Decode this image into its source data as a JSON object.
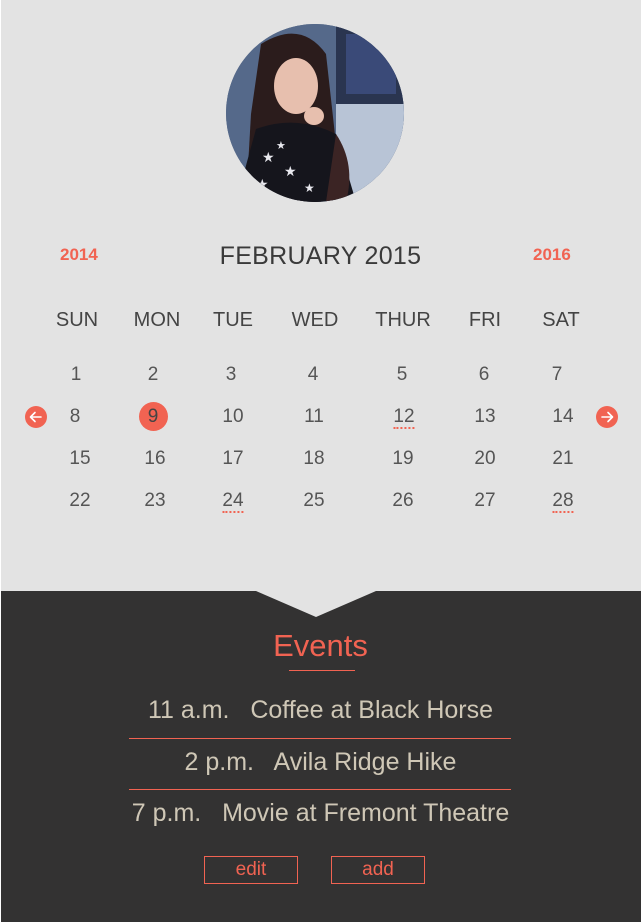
{
  "calendar": {
    "prev_year": "2014",
    "next_year": "2016",
    "month_title": "FEBRUARY 2015",
    "weekdays": [
      "SUN",
      "MON",
      "TUE",
      "WED",
      "THUR",
      "FRI",
      "SAT"
    ],
    "weeks": [
      [
        "1",
        "2",
        "3",
        "4",
        "5",
        "6",
        "7"
      ],
      [
        "8",
        "9",
        "10",
        "11",
        "12",
        "13",
        "14"
      ],
      [
        "15",
        "16",
        "17",
        "18",
        "19",
        "20",
        "21"
      ],
      [
        "22",
        "23",
        "24",
        "25",
        "26",
        "27",
        "28"
      ]
    ],
    "selected_day": "9",
    "event_days": [
      "12",
      "24",
      "28"
    ]
  },
  "events": {
    "title": "Events",
    "items": [
      {
        "time": "11 a.m.",
        "name": "Coffee at Black Horse"
      },
      {
        "time": "2 p.m.",
        "name": "Avila Ridge Hike"
      },
      {
        "time": "7 p.m.",
        "name": "Movie at Fremont Theatre"
      }
    ],
    "edit_label": "edit",
    "add_label": "add"
  },
  "colors": {
    "accent": "#f16352",
    "panel_light": "#e3e3e3",
    "panel_dark": "#333232",
    "event_text": "#cfc7b6"
  },
  "icons": {
    "prev_month": "arrow-left-icon",
    "next_month": "arrow-right-icon"
  }
}
